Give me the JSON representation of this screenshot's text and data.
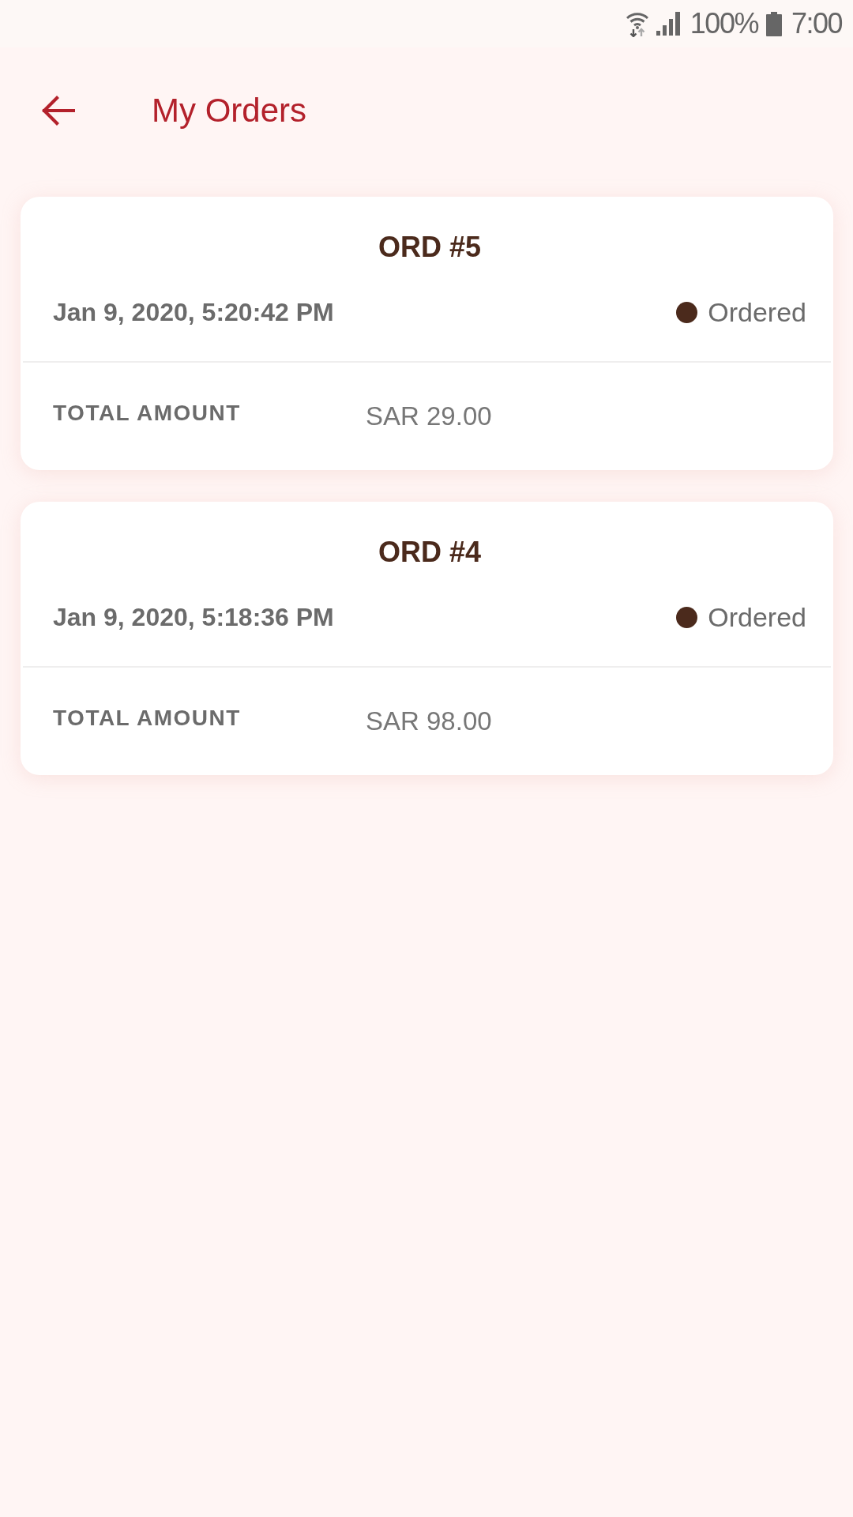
{
  "status_bar": {
    "battery": "100%",
    "time": "7:00"
  },
  "header": {
    "title": "My Orders"
  },
  "orders": [
    {
      "number": "ORD #5",
      "date": "Jan 9, 2020, 5:20:42 PM",
      "status": "Ordered",
      "total_label": "TOTAL AMOUNT",
      "total": "SAR 29.00"
    },
    {
      "number": "ORD #4",
      "date": "Jan 9, 2020, 5:18:36 PM",
      "status": "Ordered",
      "total_label": "TOTAL AMOUNT",
      "total": "SAR 98.00"
    }
  ]
}
